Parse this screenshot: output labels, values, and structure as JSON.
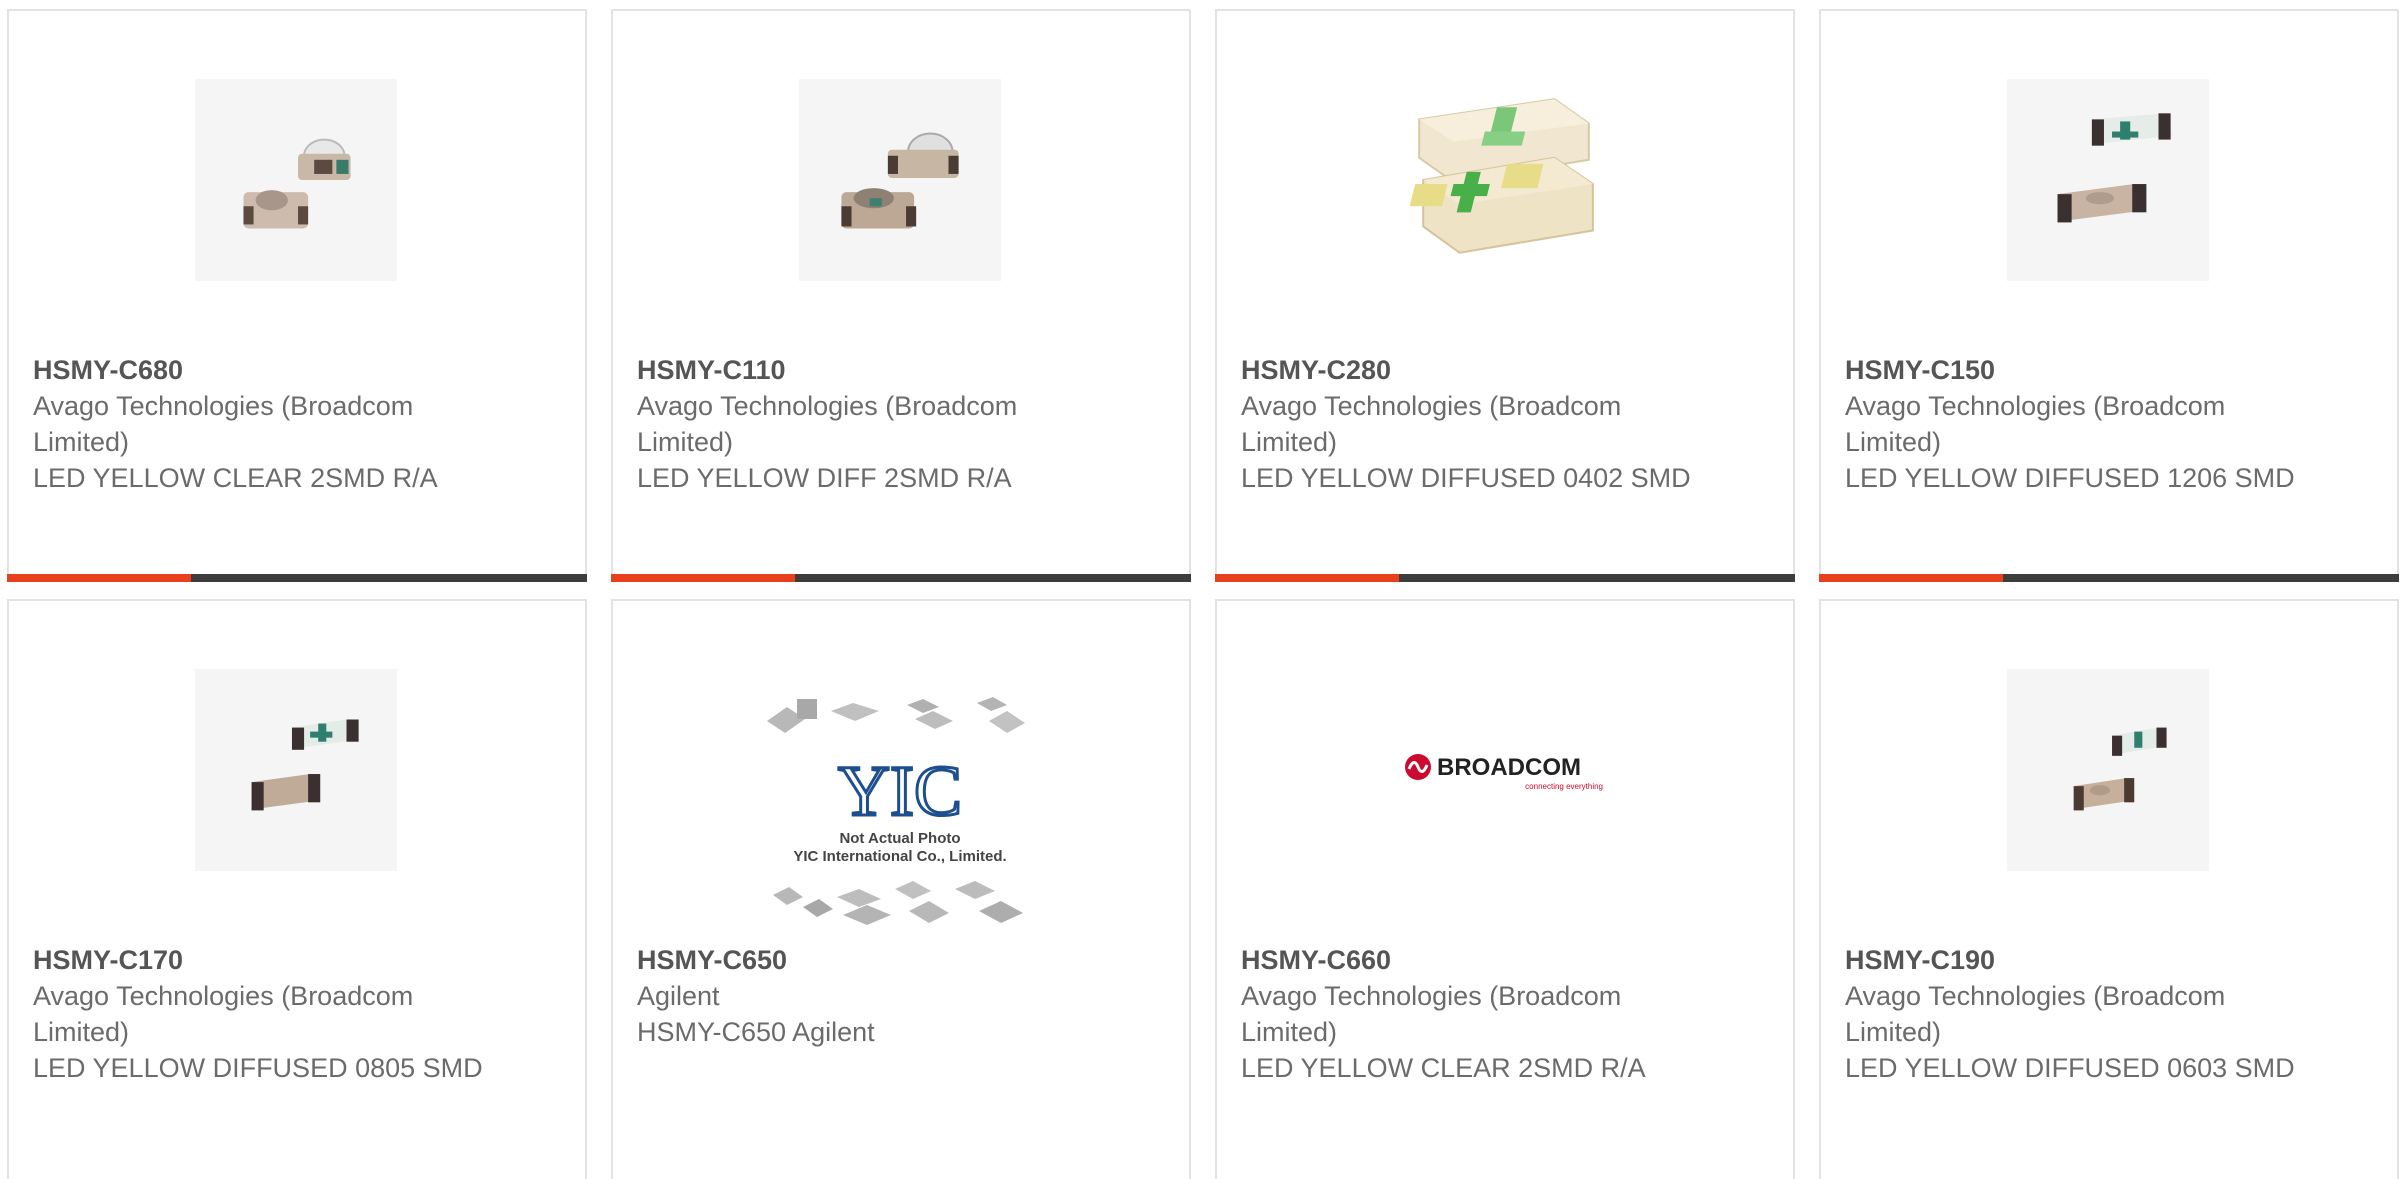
{
  "accent_color": "#e8401c",
  "bar_color": "#3d3d3d",
  "products": [
    {
      "part_number": "HSMY-C680",
      "manufacturer": "Avago Technologies (Broadcom Limited)",
      "description": "LED YELLOW CLEAR 2SMD R/A",
      "image": "led-right-angle-clear-icon"
    },
    {
      "part_number": "HSMY-C110",
      "manufacturer": "Avago Technologies (Broadcom Limited)",
      "description": "LED YELLOW DIFF 2SMD R/A",
      "image": "led-right-angle-diffused-icon"
    },
    {
      "part_number": "HSMY-C280",
      "manufacturer": "Avago Technologies (Broadcom Limited)",
      "description": "LED YELLOW DIFFUSED 0402 SMD",
      "image": "led-0402-chip-icon"
    },
    {
      "part_number": "HSMY-C150",
      "manufacturer": "Avago Technologies (Broadcom Limited)",
      "description": "LED YELLOW DIFFUSED 1206 SMD",
      "image": "led-1206-chip-icon"
    },
    {
      "part_number": "HSMY-C170",
      "manufacturer": "Avago Technologies (Broadcom Limited)",
      "description": "LED YELLOW DIFFUSED 0805 SMD",
      "image": "led-0805-chip-icon"
    },
    {
      "part_number": "HSMY-C650",
      "manufacturer": "Agilent",
      "description": "HSMY-C650 Agilent",
      "image": "not-actual-photo-placeholder",
      "placeholder_logo": "YIC",
      "placeholder_line1": "Not Actual Photo",
      "placeholder_line2": "YIC International Co., Limited."
    },
    {
      "part_number": "HSMY-C660",
      "manufacturer": "Avago Technologies (Broadcom Limited)",
      "description": "LED YELLOW CLEAR 2SMD R/A",
      "image": "broadcom-logo",
      "logo_text": "BROADCOM",
      "logo_tagline": "connecting everything"
    },
    {
      "part_number": "HSMY-C190",
      "manufacturer": "Avago Technologies (Broadcom Limited)",
      "description": "LED YELLOW DIFFUSED 0603 SMD",
      "image": "led-0603-chip-icon"
    }
  ]
}
